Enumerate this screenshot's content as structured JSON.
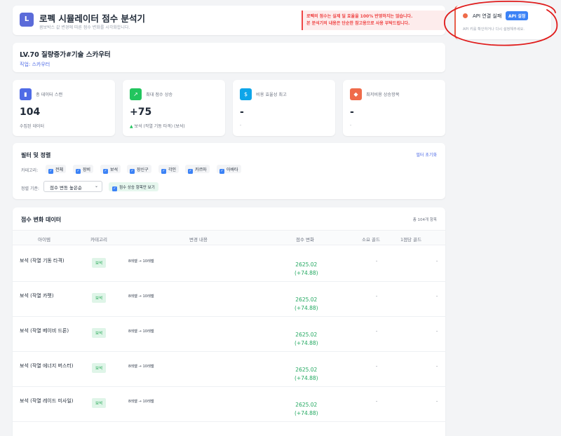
{
  "header": {
    "logo_letter": "L",
    "title": "로펙 시뮬레이터 점수 분석기",
    "subtitle": "콤보박스 값 변경에 따른 점수 변화를 시각화합니다.",
    "warning_line1": "로펙의 점수는 실제 딜 효율을 100% 반영하지는 않습니다.",
    "warning_line2": "본 분석기의 내용은 단순한 참고용으로 사용 부탁드립니다."
  },
  "api": {
    "status": "API 연결 실패",
    "button": "API 설정",
    "message": "API 키를 확인하거나 다시 설정해주세요.",
    "status_color": "#ef6b4a"
  },
  "character": {
    "name": "LV.70 질량증가#기술 스카우터",
    "job": "직업: 스카우터"
  },
  "stats": [
    {
      "icon": "bar-chart-icon",
      "glyph": "▮",
      "color": "#4f6be6",
      "label": "총 데이터 스캔",
      "value": "104",
      "sub": "수집된 데이터"
    },
    {
      "icon": "trend-up-icon",
      "glyph": "↗",
      "color": "#22c55e",
      "label": "최대 점수 상승",
      "value": "+75",
      "sub_arrow": "▲",
      "sub": "보석 (작열 기동 타격) (보석)"
    },
    {
      "icon": "money-bag-icon",
      "glyph": "$",
      "color": "#0ea5e9",
      "label": "비용 효율성 최고",
      "value": "-",
      "sub": "-"
    },
    {
      "icon": "gem-icon",
      "glyph": "◆",
      "color": "#ef6b4a",
      "label": "최저비용 상승항목",
      "value": "-",
      "sub": "-"
    }
  ],
  "filter": {
    "title": "필터 및 정렬",
    "reset": "필터 초기화",
    "category_label": "카테고리:",
    "categories": [
      "전체",
      "장비",
      "보석",
      "장신구",
      "각인",
      "카르마",
      "아바타"
    ],
    "sort_label": "정렬 기준:",
    "sort_value": "점수 변동 높은순",
    "only_increase": "점수 상승 항목만 보기"
  },
  "table": {
    "title": "점수 변화 데이터",
    "count": "총 104개 항목",
    "columns": [
      "아이템",
      "카테고리",
      "변경 내용",
      "점수 변화",
      "소요 골드",
      "1점당 골드"
    ],
    "rows": [
      {
        "item": "보석 (작열 기동 타격)",
        "category": "보석",
        "change": "8레벨 → 10레벨",
        "score": "2625.02",
        "delta": "(+74.88)",
        "gold": "-",
        "per_point": "-"
      },
      {
        "item": "보석 (작열 카펫)",
        "category": "보석",
        "change": "8레벨 → 10레벨",
        "score": "2625.02",
        "delta": "(+74.88)",
        "gold": "-",
        "per_point": "-"
      },
      {
        "item": "보석 (작열 베이비 드론)",
        "category": "보석",
        "change": "8레벨 → 10레벨",
        "score": "2625.02",
        "delta": "(+74.88)",
        "gold": "-",
        "per_point": "-"
      },
      {
        "item": "보석 (작열 에너지 버스터)",
        "category": "보석",
        "change": "8레벨 → 10레벨",
        "score": "2625.02",
        "delta": "(+74.88)",
        "gold": "-",
        "per_point": "-"
      },
      {
        "item": "보석 (작열 레이드 미사일)",
        "category": "보석",
        "change": "8레벨 → 10레벨",
        "score": "2625.02",
        "delta": "(+74.88)",
        "gold": "-",
        "per_point": "-"
      }
    ]
  },
  "colors": {
    "accent": "#4f6be6",
    "positive": "#22a860",
    "warning": "#ef4444",
    "annotation": "#e01b1b"
  }
}
